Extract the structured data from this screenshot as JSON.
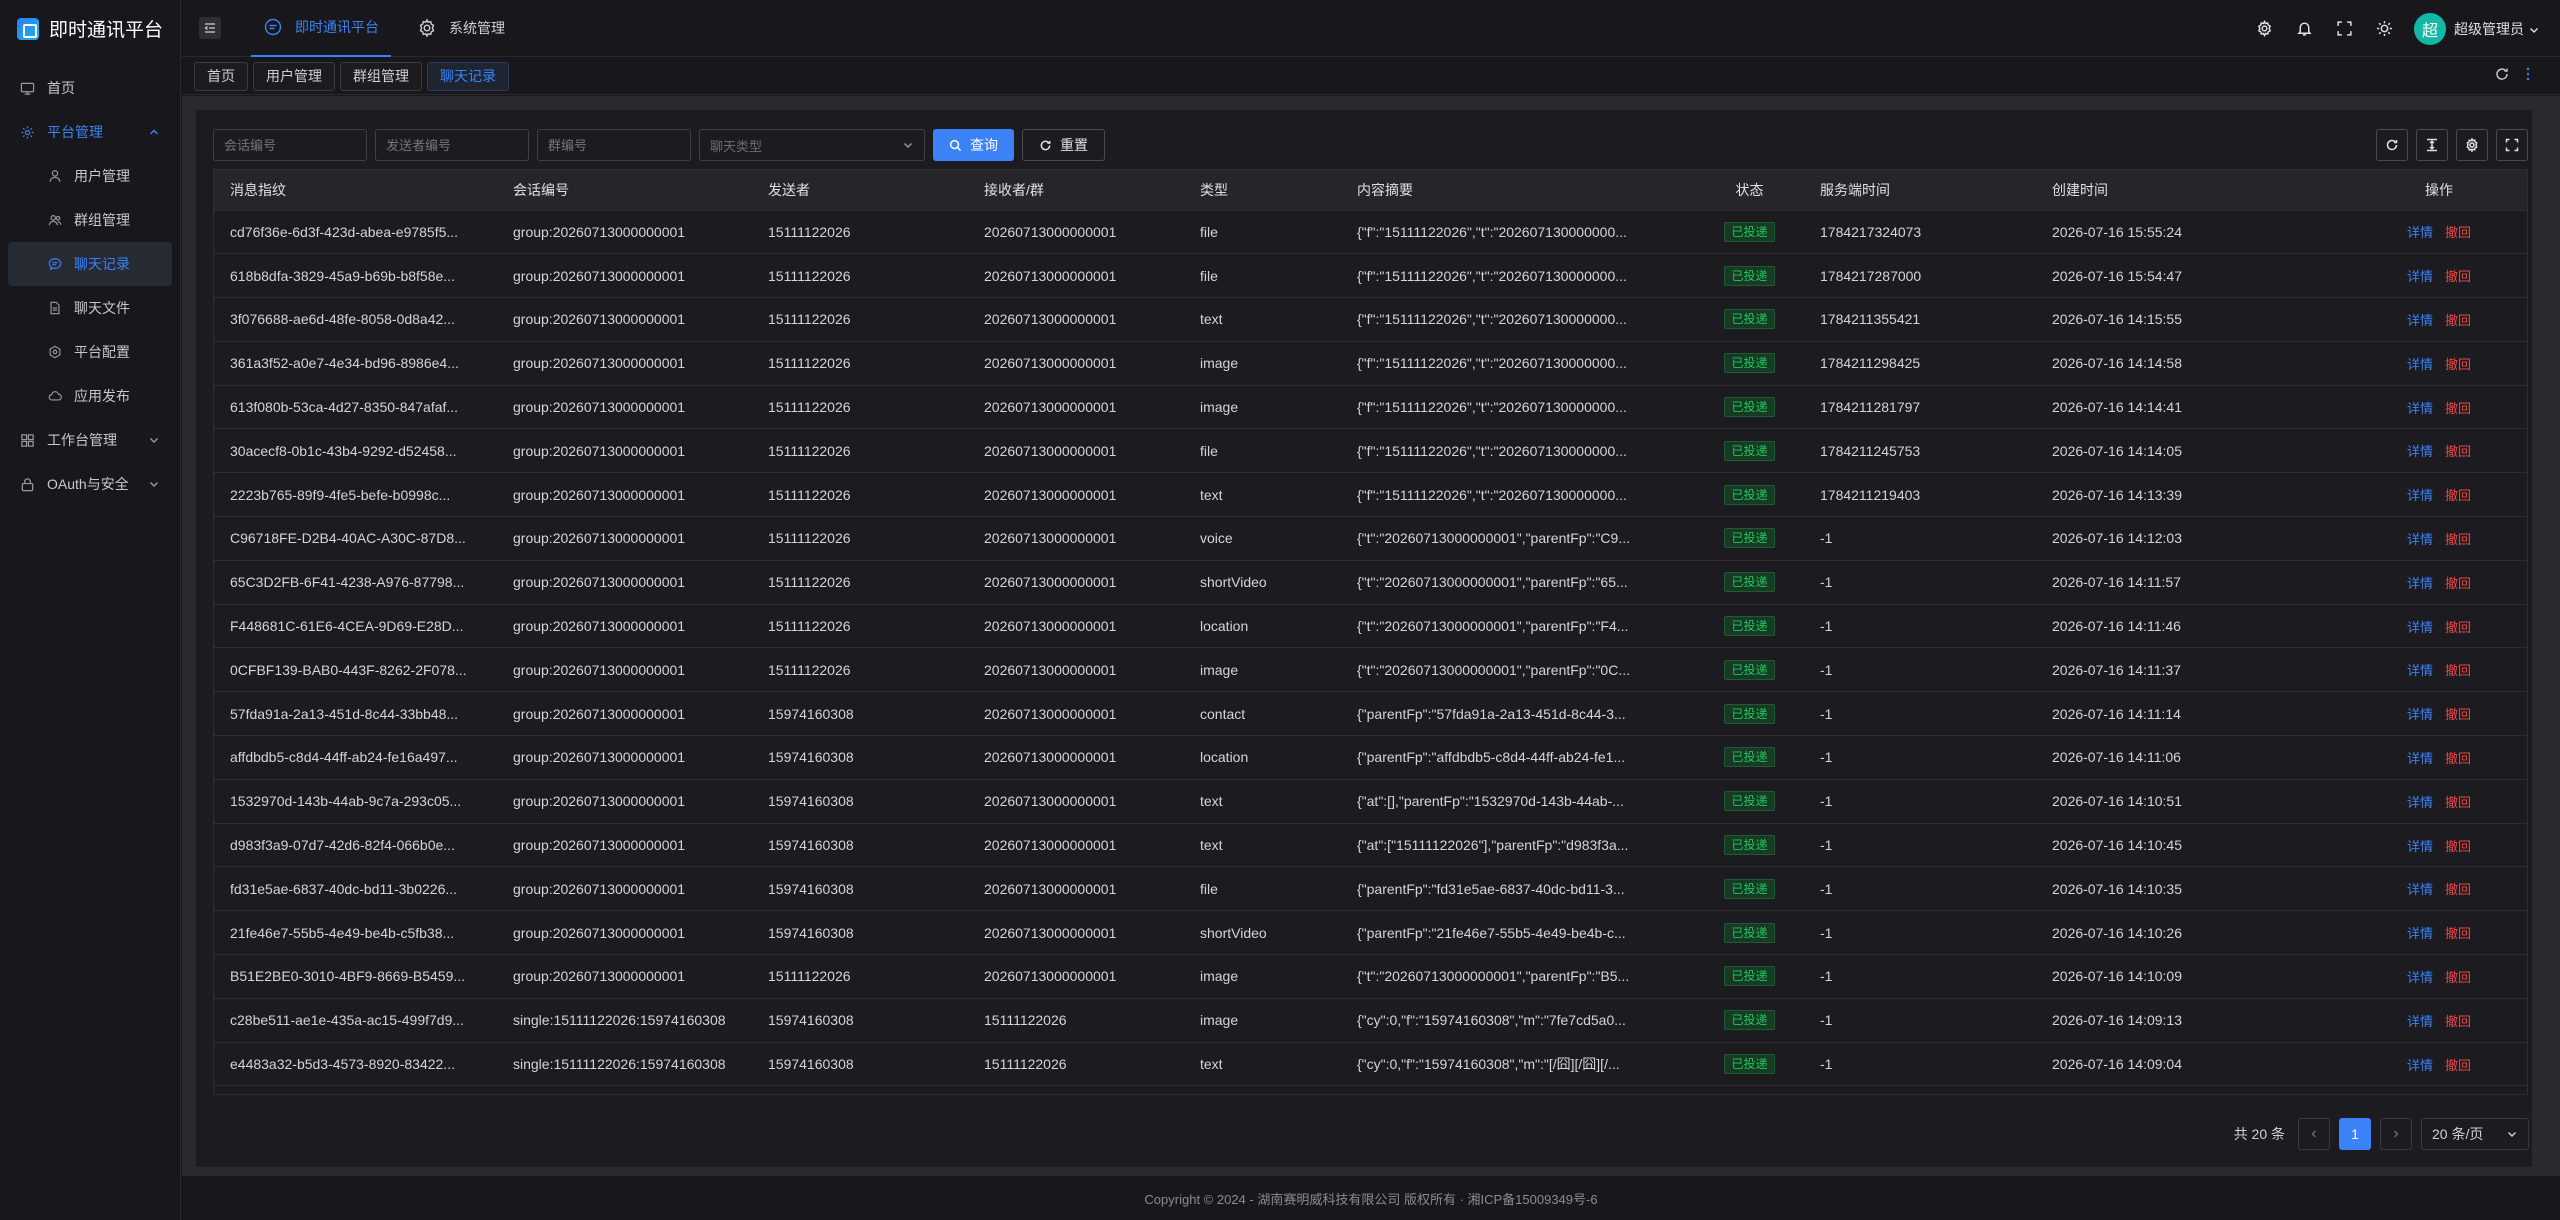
{
  "app": {
    "title": "即时通讯平台"
  },
  "sidebar": {
    "items": [
      {
        "label": "首页",
        "icon": "monitor-icon"
      },
      {
        "label": "平台管理",
        "icon": "gear-icon",
        "open": true
      },
      {
        "label": "工作台管理",
        "icon": "grid-icon"
      },
      {
        "label": "OAuth与安全",
        "icon": "lock-icon"
      }
    ],
    "sub_items": [
      {
        "label": "用户管理",
        "icon": "user-icon"
      },
      {
        "label": "群组管理",
        "icon": "group-icon"
      },
      {
        "label": "聊天记录",
        "icon": "chat-icon",
        "active": true
      },
      {
        "label": "聊天文件",
        "icon": "file-icon"
      },
      {
        "label": "平台配置",
        "icon": "settings-icon"
      },
      {
        "label": "应用发布",
        "icon": "cloud-icon"
      }
    ]
  },
  "header": {
    "nav": [
      {
        "label": "即时通讯平台",
        "icon": "chat-bubble-icon",
        "active": true
      },
      {
        "label": "系统管理",
        "icon": "gear-icon"
      }
    ],
    "user_name": "超级管理员",
    "avatar_text": "超"
  },
  "tabs": [
    {
      "label": "首页"
    },
    {
      "label": "用户管理"
    },
    {
      "label": "群组管理"
    },
    {
      "label": "聊天记录",
      "active": true
    }
  ],
  "filters": {
    "session_placeholder": "会话编号",
    "sender_placeholder": "发送者编号",
    "group_placeholder": "群编号",
    "type_placeholder": "聊天类型",
    "query_label": "查询",
    "reset_label": "重置"
  },
  "table": {
    "columns": [
      "消息指纹",
      "会话编号",
      "发送者",
      "接收者/群",
      "类型",
      "内容摘要",
      "状态",
      "服务端时间",
      "创建时间",
      "操作"
    ],
    "detail_label": "详情",
    "revoke_label": "撤回",
    "rows": [
      [
        "cd76f36e-6d3f-423d-abea-e9785f5...",
        "group:20260713000000001",
        "15111122026",
        "20260713000000001",
        "file",
        "{\"f\":\"15111122026\",\"t\":\"202607130000000...",
        "已投递",
        "1784217324073",
        "2026-07-16 15:55:24"
      ],
      [
        "618b8dfa-3829-45a9-b69b-b8f58e...",
        "group:20260713000000001",
        "15111122026",
        "20260713000000001",
        "file",
        "{\"f\":\"15111122026\",\"t\":\"202607130000000...",
        "已投递",
        "1784217287000",
        "2026-07-16 15:54:47"
      ],
      [
        "3f076688-ae6d-48fe-8058-0d8a42...",
        "group:20260713000000001",
        "15111122026",
        "20260713000000001",
        "text",
        "{\"f\":\"15111122026\",\"t\":\"202607130000000...",
        "已投递",
        "1784211355421",
        "2026-07-16 14:15:55"
      ],
      [
        "361a3f52-a0e7-4e34-bd96-8986e4...",
        "group:20260713000000001",
        "15111122026",
        "20260713000000001",
        "image",
        "{\"f\":\"15111122026\",\"t\":\"202607130000000...",
        "已投递",
        "1784211298425",
        "2026-07-16 14:14:58"
      ],
      [
        "613f080b-53ca-4d27-8350-847afaf...",
        "group:20260713000000001",
        "15111122026",
        "20260713000000001",
        "image",
        "{\"f\":\"15111122026\",\"t\":\"202607130000000...",
        "已投递",
        "1784211281797",
        "2026-07-16 14:14:41"
      ],
      [
        "30acecf8-0b1c-43b4-9292-d52458...",
        "group:20260713000000001",
        "15111122026",
        "20260713000000001",
        "file",
        "{\"f\":\"15111122026\",\"t\":\"202607130000000...",
        "已投递",
        "1784211245753",
        "2026-07-16 14:14:05"
      ],
      [
        "2223b765-89f9-4fe5-befe-b0998c...",
        "group:20260713000000001",
        "15111122026",
        "20260713000000001",
        "text",
        "{\"f\":\"15111122026\",\"t\":\"202607130000000...",
        "已投递",
        "1784211219403",
        "2026-07-16 14:13:39"
      ],
      [
        "C96718FE-D2B4-40AC-A30C-87D8...",
        "group:20260713000000001",
        "15111122026",
        "20260713000000001",
        "voice",
        "{\"t\":\"20260713000000001\",\"parentFp\":\"C9...",
        "已投递",
        "-1",
        "2026-07-16 14:12:03"
      ],
      [
        "65C3D2FB-6F41-4238-A976-87798...",
        "group:20260713000000001",
        "15111122026",
        "20260713000000001",
        "shortVideo",
        "{\"t\":\"20260713000000001\",\"parentFp\":\"65...",
        "已投递",
        "-1",
        "2026-07-16 14:11:57"
      ],
      [
        "F448681C-61E6-4CEA-9D69-E28D...",
        "group:20260713000000001",
        "15111122026",
        "20260713000000001",
        "location",
        "{\"t\":\"20260713000000001\",\"parentFp\":\"F4...",
        "已投递",
        "-1",
        "2026-07-16 14:11:46"
      ],
      [
        "0CFBF139-BAB0-443F-8262-2F078...",
        "group:20260713000000001",
        "15111122026",
        "20260713000000001",
        "image",
        "{\"t\":\"20260713000000001\",\"parentFp\":\"0C...",
        "已投递",
        "-1",
        "2026-07-16 14:11:37"
      ],
      [
        "57fda91a-2a13-451d-8c44-33bb48...",
        "group:20260713000000001",
        "15974160308",
        "20260713000000001",
        "contact",
        "{\"parentFp\":\"57fda91a-2a13-451d-8c44-3...",
        "已投递",
        "-1",
        "2026-07-16 14:11:14"
      ],
      [
        "affdbdb5-c8d4-44ff-ab24-fe16a497...",
        "group:20260713000000001",
        "15974160308",
        "20260713000000001",
        "location",
        "{\"parentFp\":\"affdbdb5-c8d4-44ff-ab24-fe1...",
        "已投递",
        "-1",
        "2026-07-16 14:11:06"
      ],
      [
        "1532970d-143b-44ab-9c7a-293c05...",
        "group:20260713000000001",
        "15974160308",
        "20260713000000001",
        "text",
        "{\"at\":[],\"parentFp\":\"1532970d-143b-44ab-...",
        "已投递",
        "-1",
        "2026-07-16 14:10:51"
      ],
      [
        "d983f3a9-07d7-42d6-82f4-066b0e...",
        "group:20260713000000001",
        "15974160308",
        "20260713000000001",
        "text",
        "{\"at\":[\"15111122026\"],\"parentFp\":\"d983f3a...",
        "已投递",
        "-1",
        "2026-07-16 14:10:45"
      ],
      [
        "fd31e5ae-6837-40dc-bd11-3b0226...",
        "group:20260713000000001",
        "15974160308",
        "20260713000000001",
        "file",
        "{\"parentFp\":\"fd31e5ae-6837-40dc-bd11-3...",
        "已投递",
        "-1",
        "2026-07-16 14:10:35"
      ],
      [
        "21fe46e7-55b5-4e49-be4b-c5fb38...",
        "group:20260713000000001",
        "15974160308",
        "20260713000000001",
        "shortVideo",
        "{\"parentFp\":\"21fe46e7-55b5-4e49-be4b-c...",
        "已投递",
        "-1",
        "2026-07-16 14:10:26"
      ],
      [
        "B51E2BE0-3010-4BF9-8669-B5459...",
        "group:20260713000000001",
        "15111122026",
        "20260713000000001",
        "image",
        "{\"t\":\"20260713000000001\",\"parentFp\":\"B5...",
        "已投递",
        "-1",
        "2026-07-16 14:10:09"
      ],
      [
        "c28be511-ae1e-435a-ac15-499f7d9...",
        "single:15111122026:15974160308",
        "15974160308",
        "15111122026",
        "image",
        "{\"cy\":0,\"f\":\"15974160308\",\"m\":\"7fe7cd5a0...",
        "已投递",
        "-1",
        "2026-07-16 14:09:13"
      ],
      [
        "e4483a32-b5d3-4573-8920-83422...",
        "single:15111122026:15974160308",
        "15974160308",
        "15111122026",
        "text",
        "{\"cy\":0,\"f\":\"15974160308\",\"m\":\"[/囧][/囧][/...",
        "已投递",
        "-1",
        "2026-07-16 14:09:04"
      ]
    ]
  },
  "pagination": {
    "total_label": "共 20 条",
    "current_page": "1",
    "page_size_label": "20 条/页"
  },
  "footer": {
    "text": "Copyright © 2024 - 湖南赛明威科技有限公司 版权所有 · 湘ICP备15009349号-6"
  },
  "colors": {
    "accent": "#3b82f6",
    "success": "#22c55e",
    "danger": "#ef4444",
    "avatar": "#14b8a6"
  }
}
